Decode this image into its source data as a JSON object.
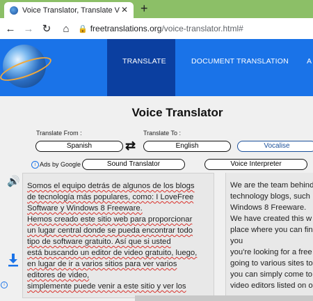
{
  "browser": {
    "tab_title": "Voice Translator, Translate Voice",
    "tab_close": "✕",
    "new_tab": "+",
    "url_main": "freetranslations.org",
    "url_path": "/voice-translator.html#"
  },
  "site": {
    "nav": [
      "TRANSLATE",
      "DOCUMENT TRANSLATION",
      "A"
    ]
  },
  "tool": {
    "title": "Voice Translator",
    "from_label": "Translate From :",
    "to_label": "Translate To :",
    "from_value": "Spanish",
    "to_value": "English",
    "vocalise": "Vocalise",
    "ads": "Ads by Google",
    "sound_translator": "Sound Translator",
    "voice_interpreter": "Voice Interpreter"
  },
  "source_lines": [
    "Somos el equipo detrás de algunos de los blogs",
    "de tecnología más populares, como: I LoveFree",
    "Software y Windows 8 Freeware.",
    "Hemos creado este sitio web para proporcionar",
    "un lugar central donde se pueda encontrar todo",
    "tipo de software gratuito. Así que si usted",
    "está buscando un editor de video gratuito, luego,",
    "en lugar de ir a varios sitios para ver varios",
    "editores de video,",
    "simplemente puede venir a este sitio y ver los"
  ],
  "target_lines": [
    "We are the team behind",
    "technology blogs, such",
    "Windows 8 Freeware.",
    "We have created this w",
    "place where you can fin",
    "you",
    "you're looking for a free",
    "going to various sites to",
    "you can simply come to",
    "video editors listed on o"
  ],
  "colors": {
    "header_blue": "#1a73e8",
    "nav_active": "#0b3fa0",
    "tabbar_green": "#8cbf67",
    "speaker_red": "#e0191e",
    "download_blue": "#1a73e8"
  }
}
